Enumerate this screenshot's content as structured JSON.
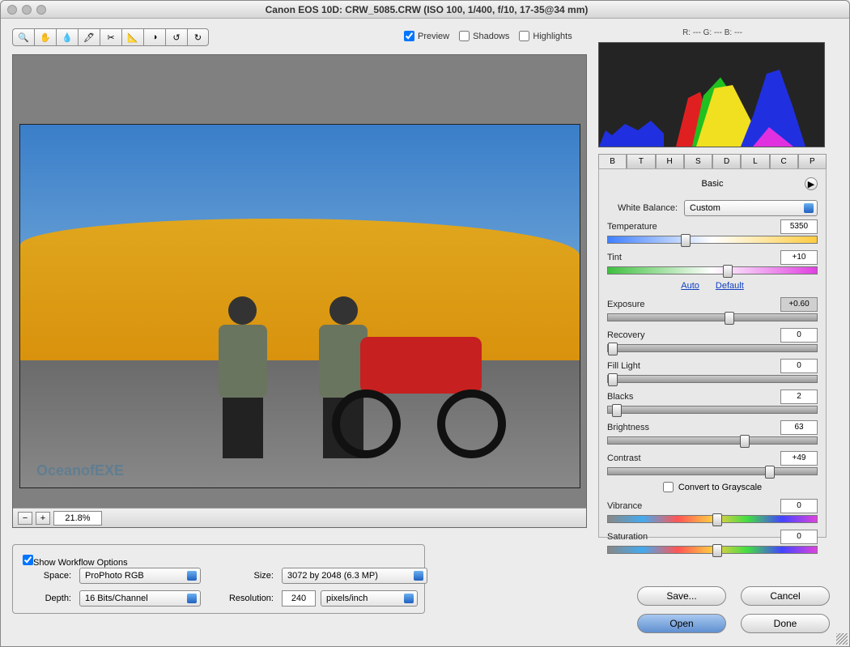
{
  "window": {
    "title": "Canon EOS 10D:  CRW_5085.CRW  (ISO 100, 1/400, f/10, 17-35@34 mm)"
  },
  "toolbar": {
    "tools": [
      "zoom",
      "hand",
      "white-balance",
      "color-sampler",
      "crop",
      "straighten",
      "retouch",
      "rotate-ccw",
      "rotate-cw"
    ]
  },
  "previewOptions": {
    "preview": {
      "label": "Preview",
      "checked": true
    },
    "shadows": {
      "label": "Shadows",
      "checked": false
    },
    "highlights": {
      "label": "Highlights",
      "checked": false
    }
  },
  "rgb": {
    "text": "R: ---   G: ---   B: ---"
  },
  "zoom": {
    "minus": "−",
    "plus": "+",
    "value": "21.8%"
  },
  "tabs": [
    "B",
    "T",
    "H",
    "S",
    "D",
    "L",
    "C",
    "P"
  ],
  "panelTitle": "Basic",
  "wb": {
    "label": "White Balance:",
    "value": "Custom"
  },
  "sliders": {
    "temperature": {
      "label": "Temperature",
      "value": "5350",
      "pos": 35
    },
    "tint": {
      "label": "Tint",
      "value": "+10",
      "pos": 55
    },
    "exposure": {
      "label": "Exposure",
      "value": "+0.60",
      "pos": 56
    },
    "recovery": {
      "label": "Recovery",
      "value": "0",
      "pos": 0
    },
    "filllight": {
      "label": "Fill Light",
      "value": "0",
      "pos": 0
    },
    "blacks": {
      "label": "Blacks",
      "value": "2",
      "pos": 2
    },
    "brightness": {
      "label": "Brightness",
      "value": "63",
      "pos": 63
    },
    "contrast": {
      "label": "Contrast",
      "value": "+49",
      "pos": 75
    },
    "vibrance": {
      "label": "Vibrance",
      "value": "0",
      "pos": 50
    },
    "saturation": {
      "label": "Saturation",
      "value": "0",
      "pos": 50
    }
  },
  "links": {
    "auto": "Auto",
    "default": "Default"
  },
  "grayscale": {
    "label": "Convert to Grayscale",
    "checked": false
  },
  "workflow": {
    "show": {
      "label": "Show Workflow Options",
      "checked": true
    },
    "spaceLabel": "Space:",
    "space": "ProPhoto RGB",
    "sizeLabel": "Size:",
    "size": "3072 by 2048  (6.3 MP)",
    "depthLabel": "Depth:",
    "depth": "16 Bits/Channel",
    "resLabel": "Resolution:",
    "resVal": "240",
    "resUnit": "pixels/inch"
  },
  "buttons": {
    "save": "Save...",
    "cancel": "Cancel",
    "open": "Open",
    "done": "Done"
  },
  "watermark": "OceanofEXE"
}
